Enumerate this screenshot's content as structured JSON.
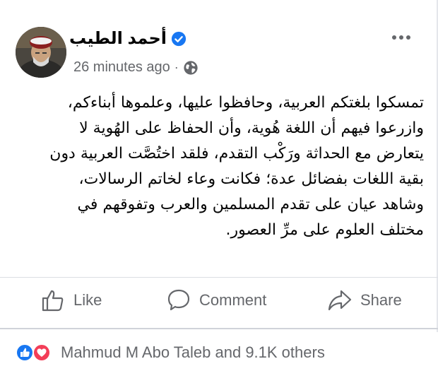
{
  "post": {
    "author": "أحمد الطيب",
    "timestamp": "26 minutes ago",
    "separator": "·",
    "audience_icon": "globe-icon",
    "verified_icon": "verified-badge-icon",
    "more_icon": "more-options-icon",
    "text_lines": [
      "تمسكوا بلغتكم العربية، وحافظوا عليها، وعلموها أبناءكم،",
      "وازرعوا فيهم أن اللغة هُوية، وأن الحفاظ على الهُوية لا",
      "يتعارض مع الحداثة ورَكْب التقدم، فلقد اختُصَّت العربية دون",
      "بقية اللغات بفضائل عدة؛ فكانت وعاء لخاتم الرسالات،",
      "وشاهد عيان على تقدم المسلمين والعرب وتفوقهم في",
      "مختلف العلوم على مرِّ العصور."
    ]
  },
  "actions": {
    "like_label": "Like",
    "comment_label": "Comment",
    "share_label": "Share"
  },
  "reactions": {
    "summary": "Mahmud M Abo Taleb and 9.1K others",
    "icons": [
      "like-reaction-icon",
      "love-reaction-icon"
    ]
  },
  "colors": {
    "text": "#050505",
    "secondary": "#65676b",
    "verified": "#1877f2",
    "like": "#1877f2",
    "love": "#f33e58",
    "divider": "#dcdee3"
  }
}
